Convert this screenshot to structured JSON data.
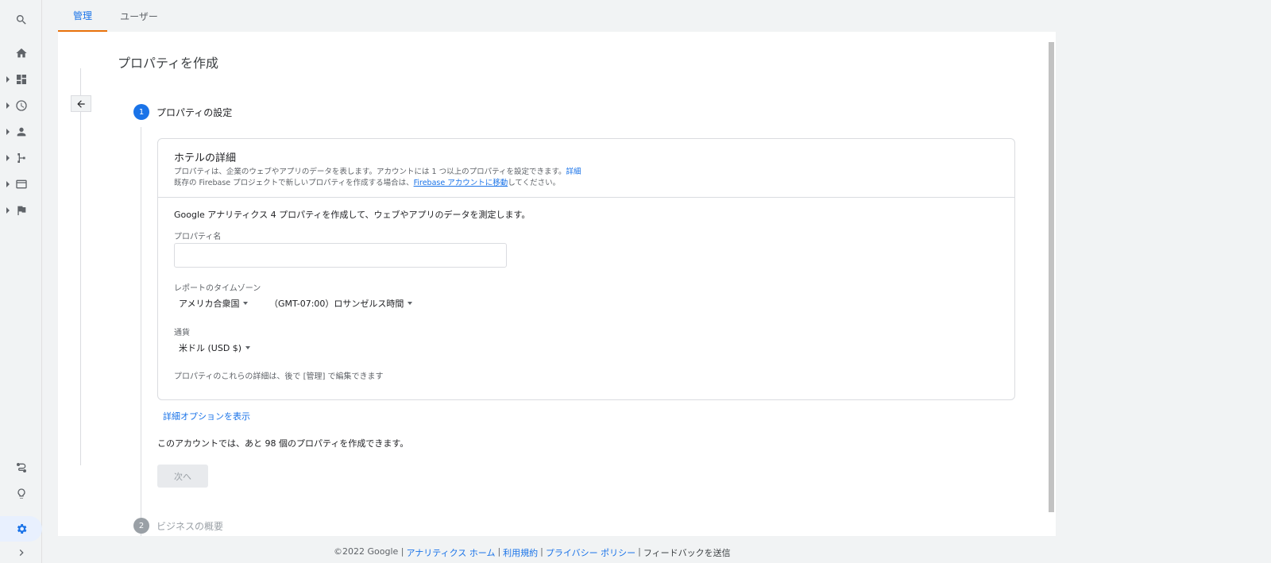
{
  "tabs": [
    {
      "label": "管理",
      "active": true
    },
    {
      "label": "ユーザー",
      "active": false
    }
  ],
  "rail": {
    "items": [
      "search-icon",
      "home-icon",
      "dashboard-icon",
      "clock-icon",
      "person-icon",
      "share-icon",
      "card-icon",
      "flag-icon",
      "route-icon",
      "lightbulb-icon",
      "settings-icon",
      "chevron-right-icon"
    ]
  },
  "page": {
    "title": "プロパティを作成",
    "step1": {
      "num": "1",
      "title": "プロパティの設定"
    },
    "step2": {
      "num": "2",
      "title": "ビジネスの概要"
    }
  },
  "card": {
    "title": "ホテルの詳細",
    "desc1": "プロパティは、企業のウェブやアプリのデータを表します。アカウントには 1 つ以上のプロパティを設定できます。",
    "desc1_link": "詳細",
    "desc2_pre": "既存の Firebase プロジェクトで新しいプロパティを作成する場合は、",
    "desc2_link": "Firebase アカウントに移動",
    "desc2_post": "してください。",
    "intro": "Google アナリティクス 4 プロパティを作成して、ウェブやアプリのデータを測定します。",
    "property_name_label": "プロパティ名",
    "property_name_value": "",
    "timezone_label": "レポートのタイムゾーン",
    "country": "アメリカ合衆国",
    "timezone": "（GMT-07:00）ロサンゼルス時間",
    "currency_label": "通貨",
    "currency": "米ドル (USD $)",
    "note": "プロパティのこれらの詳細は、後で [管理] で編集できます"
  },
  "advanced_link": "詳細オプションを表示",
  "remaining": "このアカウントでは、あと 98 個のプロパティを作成できます。",
  "next_button": "次へ",
  "footer": {
    "copyright": "©2022 Google |",
    "home": "アナリティクス ホーム",
    "sep1": "|",
    "terms": "利用規約",
    "sep2": "|",
    "privacy": "プライバシー ポリシー",
    "sep3": "|",
    "feedback": "フィードバックを送信"
  }
}
